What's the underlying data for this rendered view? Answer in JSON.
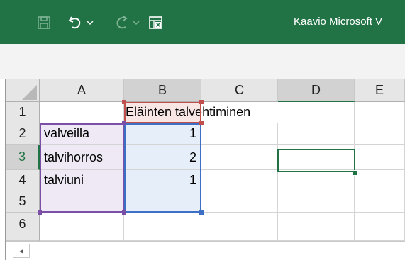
{
  "titlebar": {
    "app_title": "Kaavio Microsoft V",
    "icons": [
      "save-icon",
      "undo-icon",
      "redo-icon",
      "form-icon"
    ],
    "bg_color": "#217346"
  },
  "sheet": {
    "columns": [
      "A",
      "B",
      "C",
      "D",
      "E"
    ],
    "rows": [
      "1",
      "2",
      "3",
      "4",
      "5",
      "6"
    ],
    "cells": {
      "B1": "Eläinten talvehtiminen",
      "A2": "valveilla",
      "B2": "1",
      "A3": "talvihorros",
      "B3": "2",
      "A4": "talviuni",
      "B4": "1"
    },
    "active_cell": "D3",
    "range_colors": {
      "A": "#7b4fa8",
      "B": "#3d6fc4",
      "B1": "#c0504d"
    },
    "accent_color": "#217346"
  },
  "scroll": {
    "left_arrow": "◂"
  }
}
